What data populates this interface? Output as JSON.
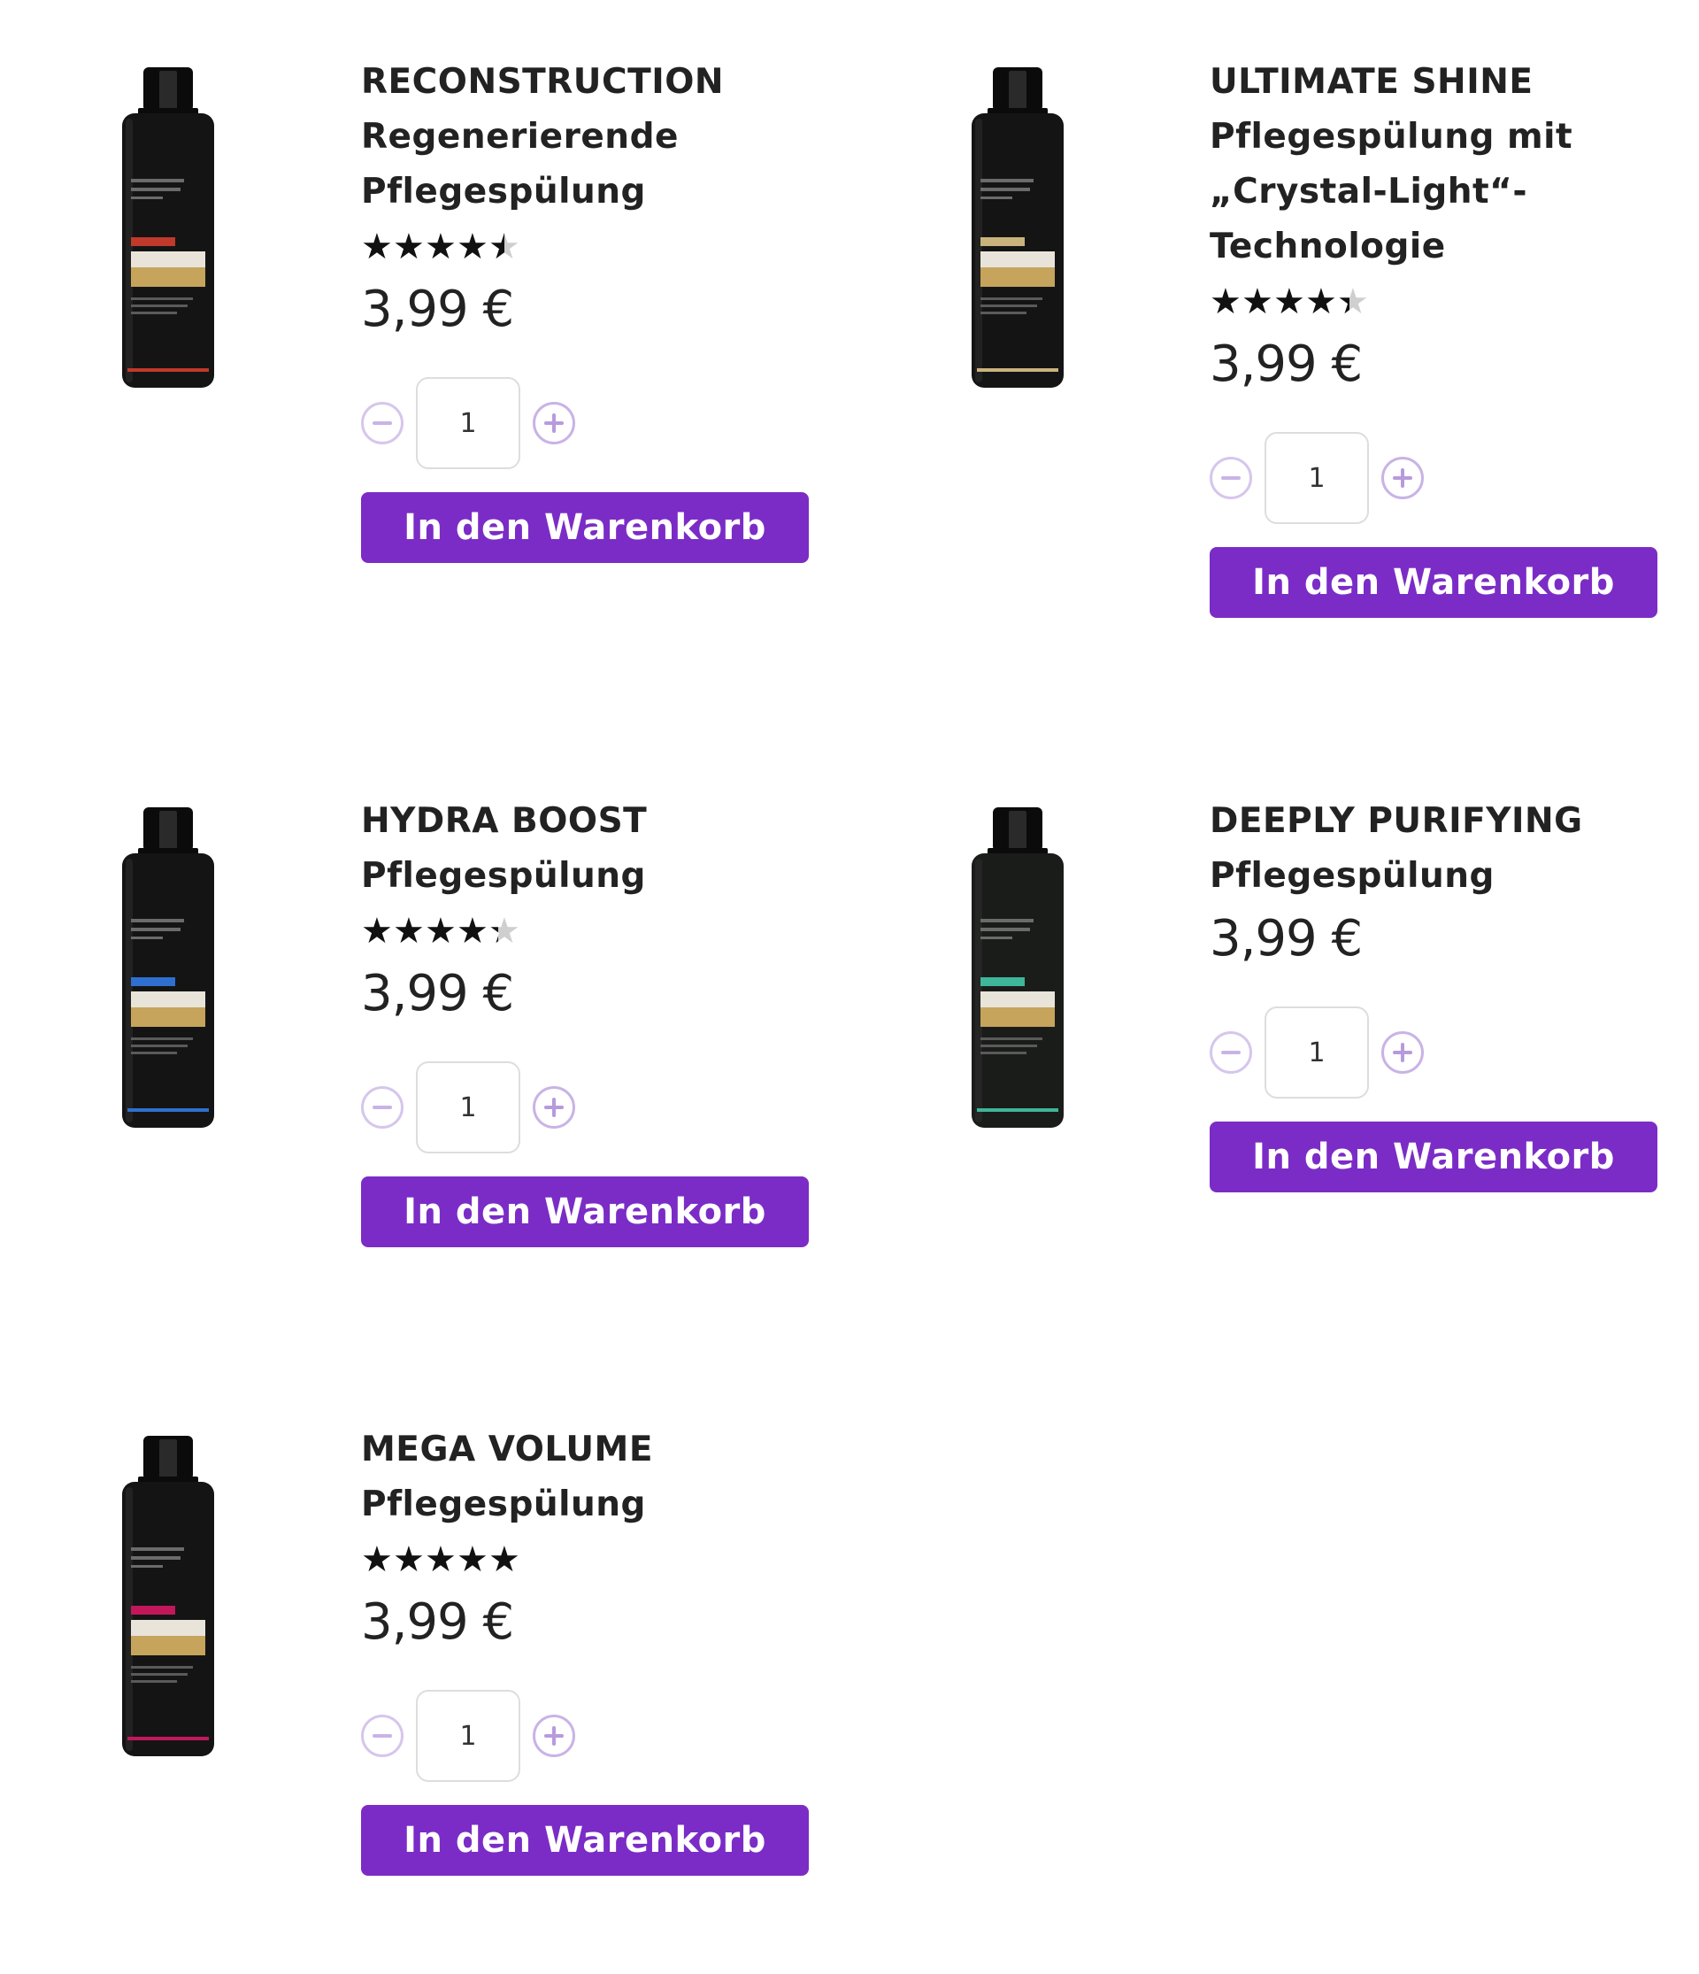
{
  "products": [
    {
      "title_lines": [
        "RECONSTRUCTION",
        "Regenerierende",
        "Pflegespülung"
      ],
      "rating": 4.5,
      "price": "3,99 €",
      "quantity": "1",
      "cart_label": "In den Warenkorb",
      "bottle_accent": "#c0392b",
      "bottle_body": "#141414",
      "bottle_label": "CONDITIONER"
    },
    {
      "title_lines": [
        "ULTIMATE SHINE",
        "Pflegespülung mit",
        "„Crystal-Light“-",
        "Technologie"
      ],
      "rating": 4.4,
      "price": "3,99 €",
      "quantity": "1",
      "cart_label": "In den Warenkorb",
      "bottle_accent": "#c9b27c",
      "bottle_body": "#141414",
      "bottle_label": "CONDITIONER"
    },
    {
      "title_lines": [
        "HYDRA BOOST",
        "Pflegespülung"
      ],
      "rating": 4.3,
      "price": "3,99 €",
      "quantity": "1",
      "cart_label": "In den Warenkorb",
      "bottle_accent": "#2f6fd0",
      "bottle_body": "#141414",
      "bottle_label": "CONDITIONER"
    },
    {
      "title_lines": [
        "DEEPLY PURIFYING",
        "Pflegespülung"
      ],
      "rating": null,
      "price": "3,99 €",
      "quantity": "1",
      "cart_label": "In den Warenkorb",
      "bottle_accent": "#3fb59a",
      "bottle_body": "#1a1c1a",
      "bottle_label": "CONDITIONER"
    },
    {
      "title_lines": [
        "MEGA VOLUME",
        "Pflegespülung"
      ],
      "rating": 5,
      "price": "3,99 €",
      "quantity": "1",
      "cart_label": "In den Warenkorb",
      "bottle_accent": "#c2185b",
      "bottle_body": "#141414",
      "bottle_label": "CONDITIONER"
    }
  ],
  "icons": {
    "minus": "minus-circle-icon",
    "plus": "plus-circle-icon",
    "star": "star-icon"
  },
  "colors": {
    "cart_button": "#7b2cc6",
    "qty_button": "#b79ade"
  }
}
